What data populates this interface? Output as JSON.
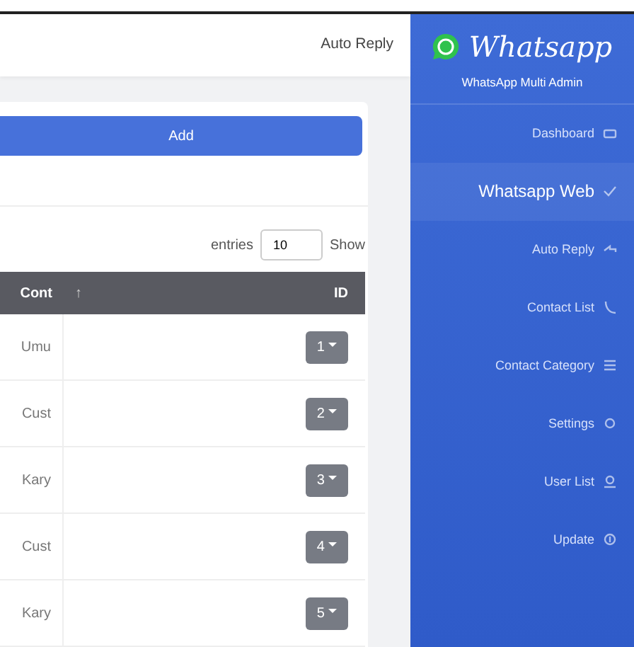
{
  "sidebar": {
    "logo_text": "Whatsapp",
    "app_name": "WhatsApp Multi Admin",
    "items": [
      {
        "label": "Dashboard",
        "highlighted": false
      },
      {
        "label": "Whatsapp Web",
        "highlighted": true
      },
      {
        "label": "Auto Reply",
        "highlighted": false
      },
      {
        "label": "Contact List",
        "highlighted": false
      },
      {
        "label": "Contact Category",
        "highlighted": false
      },
      {
        "label": "Settings",
        "highlighted": false
      },
      {
        "label": "User List",
        "highlighted": false
      },
      {
        "label": "Update",
        "highlighted": false
      }
    ]
  },
  "header": {
    "title": "Auto Reply"
  },
  "card": {
    "add_button": "Add",
    "entries_label": "entries",
    "entries_value": "10",
    "show_label": "Show"
  },
  "table": {
    "columns": [
      "Cont",
      "ID"
    ],
    "sort_arrow": "↑",
    "rows": [
      {
        "column_1": "Umu",
        "id": "1"
      },
      {
        "column_1": "Cust",
        "id": "2"
      },
      {
        "column_1": "Kary",
        "id": "3"
      },
      {
        "column_1": "Cust",
        "id": "4"
      },
      {
        "column_1": "Kary",
        "id": "5"
      }
    ]
  }
}
